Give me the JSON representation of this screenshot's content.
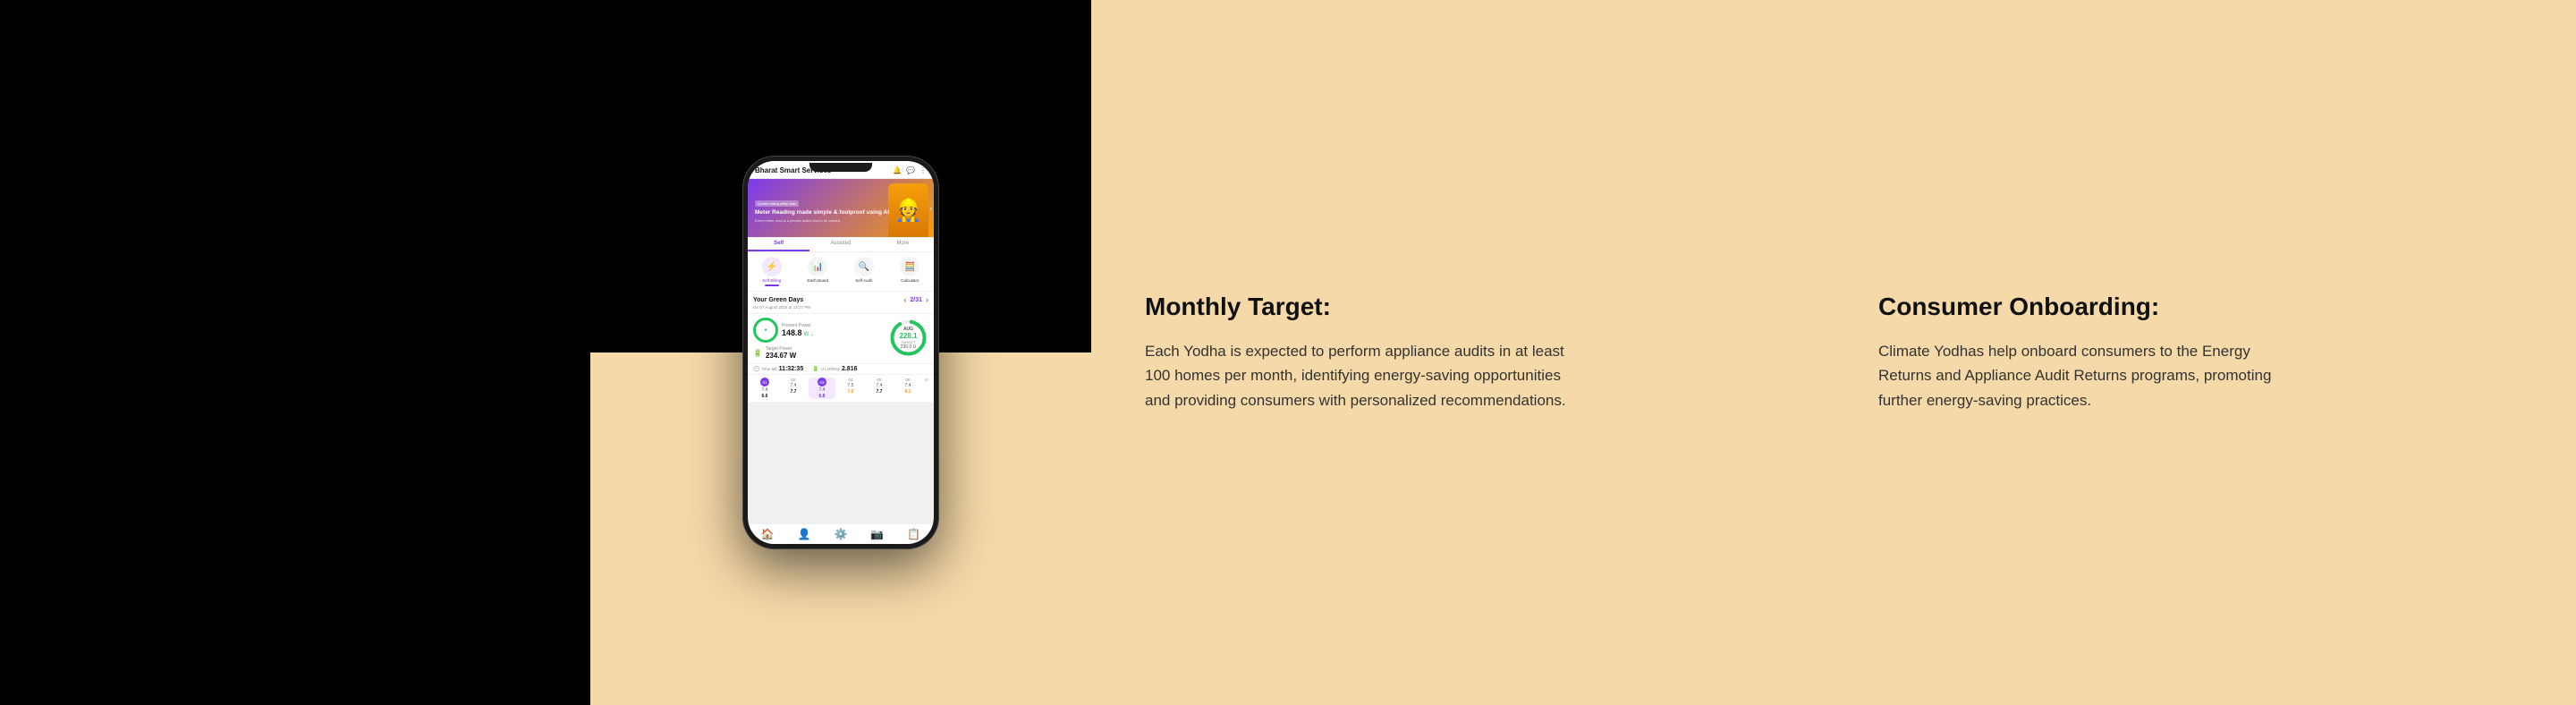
{
  "left_black": {},
  "left_text": {
    "heading": "Monthly Target:",
    "body": "Each Yodha is expected to perform appliance audits in at least 100 homes per month, identifying energy-saving opportunities and providing consumers with personalized recommendations."
  },
  "right_text": {
    "heading": "Consumer Onboarding:",
    "body": "Climate Yodhas help onboard consumers to the Energy Returns and Appliance Audit Returns programs, promoting further energy-saving practices."
  },
  "phone": {
    "app_name": "Bharat Smart Services",
    "banner": {
      "tag": "Quality billing utility wide",
      "title": "Meter Reading made simple &\nfoolproof using AI",
      "subtitle": "Every meter read is a precise action\nNot to be missed"
    },
    "tabs": [
      "Self",
      "Assisted",
      "More"
    ],
    "active_tab": "Self",
    "menu_items": [
      {
        "icon": "⚡",
        "label": "Self Billing"
      },
      {
        "icon": "📊",
        "label": "Dash Board"
      },
      {
        "icon": "🔍",
        "label": "Self Audit"
      },
      {
        "icon": "🧮",
        "label": "Calculator"
      }
    ],
    "green_days": {
      "label": "Your Green Days",
      "count": "2/31",
      "date": "On 07 August 2024 at 12:27 PM"
    },
    "present_power": {
      "label": "Present Power",
      "value": "148.8",
      "unit": "W"
    },
    "target_power": {
      "label": "Target Power",
      "value": "234.67 W"
    },
    "aug_chart": {
      "month": "AUG",
      "current": "228.1",
      "target_label": "TARGET",
      "target_value": "230.0 U"
    },
    "time_left": {
      "label": "Time left",
      "value": "11:32:35"
    },
    "units_left": {
      "label": "U Left/Day",
      "value": "2.816"
    },
    "calendar": [
      {
        "day": "01",
        "val1": "7.4",
        "val2": "6.6"
      },
      {
        "day": "02",
        "val1": "7.4",
        "val2": "7.7"
      },
      {
        "day": "03",
        "val1": "7.4",
        "val2": "6.8",
        "active": true
      },
      {
        "day": "04",
        "val1": "7.5",
        "val2": "7.9"
      },
      {
        "day": "05",
        "val1": "7.4",
        "val2": "7.7"
      },
      {
        "day": "06",
        "val1": "7.4",
        "val2": "8.1"
      }
    ],
    "bottom_nav": [
      "🏠",
      "👤",
      "⚙️",
      "📷",
      "📋"
    ]
  }
}
